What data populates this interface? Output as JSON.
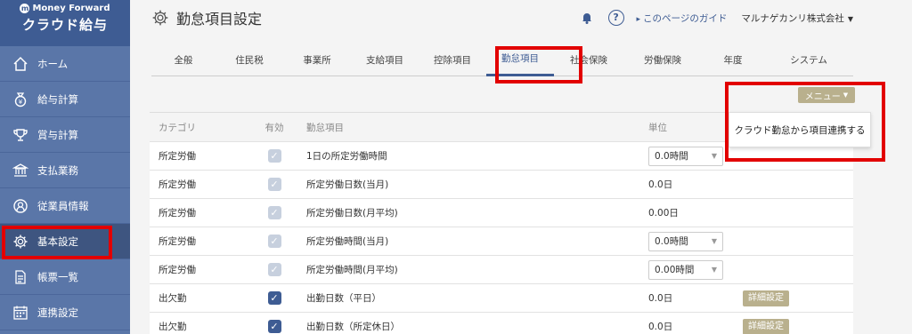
{
  "logo": {
    "brand": "Money Forward",
    "product": "クラウド給与"
  },
  "sidebar": {
    "items": [
      {
        "label": "ホーム",
        "icon": "home-icon"
      },
      {
        "label": "給与計算",
        "icon": "money-bag-icon"
      },
      {
        "label": "賞与計算",
        "icon": "trophy-icon"
      },
      {
        "label": "支払業務",
        "icon": "bank-icon"
      },
      {
        "label": "従業員情報",
        "icon": "user-icon"
      },
      {
        "label": "基本設定",
        "icon": "gear-icon"
      },
      {
        "label": "帳票一覧",
        "icon": "document-icon"
      },
      {
        "label": "連携設定",
        "icon": "calendar-icon"
      }
    ],
    "active_index": 5
  },
  "header": {
    "title": "勤怠項目設定",
    "guide_link": "このページのガイド",
    "company": "マルナゲカンリ株式会社"
  },
  "tabs": [
    {
      "label": "全般"
    },
    {
      "label": "住民税"
    },
    {
      "label": "事業所"
    },
    {
      "label": "支給項目"
    },
    {
      "label": "控除項目"
    },
    {
      "label": "勤怠項目",
      "active": true
    },
    {
      "label": "社会保険"
    },
    {
      "label": "労働保険"
    },
    {
      "label": "年度"
    },
    {
      "label": "システム"
    }
  ],
  "menu": {
    "button_label": "メニュー",
    "dropdown_item": "クラウド勤怠から項目連携する"
  },
  "table": {
    "columns": {
      "category": "カテゴリ",
      "enabled": "有効",
      "item": "勤怠項目",
      "unit": "単位"
    },
    "rows": [
      {
        "category": "所定労働",
        "enabled": true,
        "locked": true,
        "item": "1日の所定労働時間",
        "unit": "0.0時間",
        "unit_select": true,
        "detail": ""
      },
      {
        "category": "所定労働",
        "enabled": true,
        "locked": true,
        "item": "所定労働日数(当月)",
        "unit": "0.0日",
        "unit_select": false,
        "detail": ""
      },
      {
        "category": "所定労働",
        "enabled": true,
        "locked": true,
        "item": "所定労働日数(月平均)",
        "unit": "0.00日",
        "unit_select": false,
        "detail": ""
      },
      {
        "category": "所定労働",
        "enabled": true,
        "locked": true,
        "item": "所定労働時間(当月)",
        "unit": "0.0時間",
        "unit_select": true,
        "detail": ""
      },
      {
        "category": "所定労働",
        "enabled": true,
        "locked": true,
        "item": "所定労働時間(月平均)",
        "unit": "0.00時間",
        "unit_select": true,
        "detail": ""
      },
      {
        "category": "出欠勤",
        "enabled": true,
        "locked": false,
        "item": "出勤日数（平日）",
        "unit": "0.0日",
        "unit_select": false,
        "detail": "詳細設定"
      },
      {
        "category": "出欠勤",
        "enabled": true,
        "locked": false,
        "item": "出勤日数（所定休日）",
        "unit": "0.0日",
        "unit_select": false,
        "detail": "詳細設定"
      }
    ]
  },
  "colors": {
    "sidebar": "#5a76a8",
    "logo_bg": "#3e5c93",
    "accent": "#3e5c93",
    "highlight_red": "#e20000",
    "menu_button": "#b9b08d"
  }
}
